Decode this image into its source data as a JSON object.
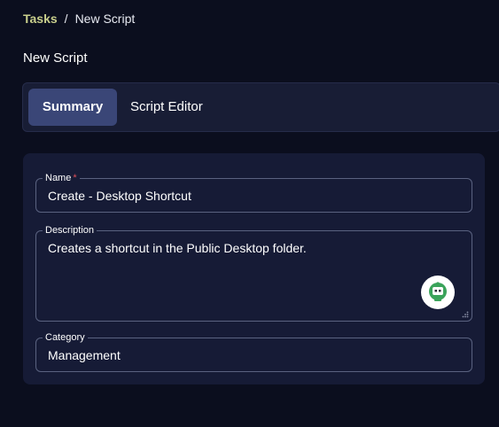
{
  "breadcrumb": {
    "parent": "Tasks",
    "separator": "/",
    "current": "New Script"
  },
  "page": {
    "title": "New Script"
  },
  "tabs": [
    {
      "label": "Summary",
      "active": true
    },
    {
      "label": "Script Editor",
      "active": false
    }
  ],
  "form": {
    "name": {
      "label": "Name",
      "required_mark": "*",
      "value": "Create - Desktop Shortcut"
    },
    "description": {
      "label": "Description",
      "value": "Creates a shortcut in the Public Desktop folder."
    },
    "category": {
      "label": "Category",
      "value": "Management"
    }
  },
  "assistant": {
    "icon": "robot-icon",
    "accent_color": "#3aa35a"
  },
  "colors": {
    "background": "#0b0e1e",
    "panel": "#161b36",
    "active_tab": "#3a4677",
    "breadcrumb_link": "#c9cf8c",
    "required": "#e0505a"
  }
}
